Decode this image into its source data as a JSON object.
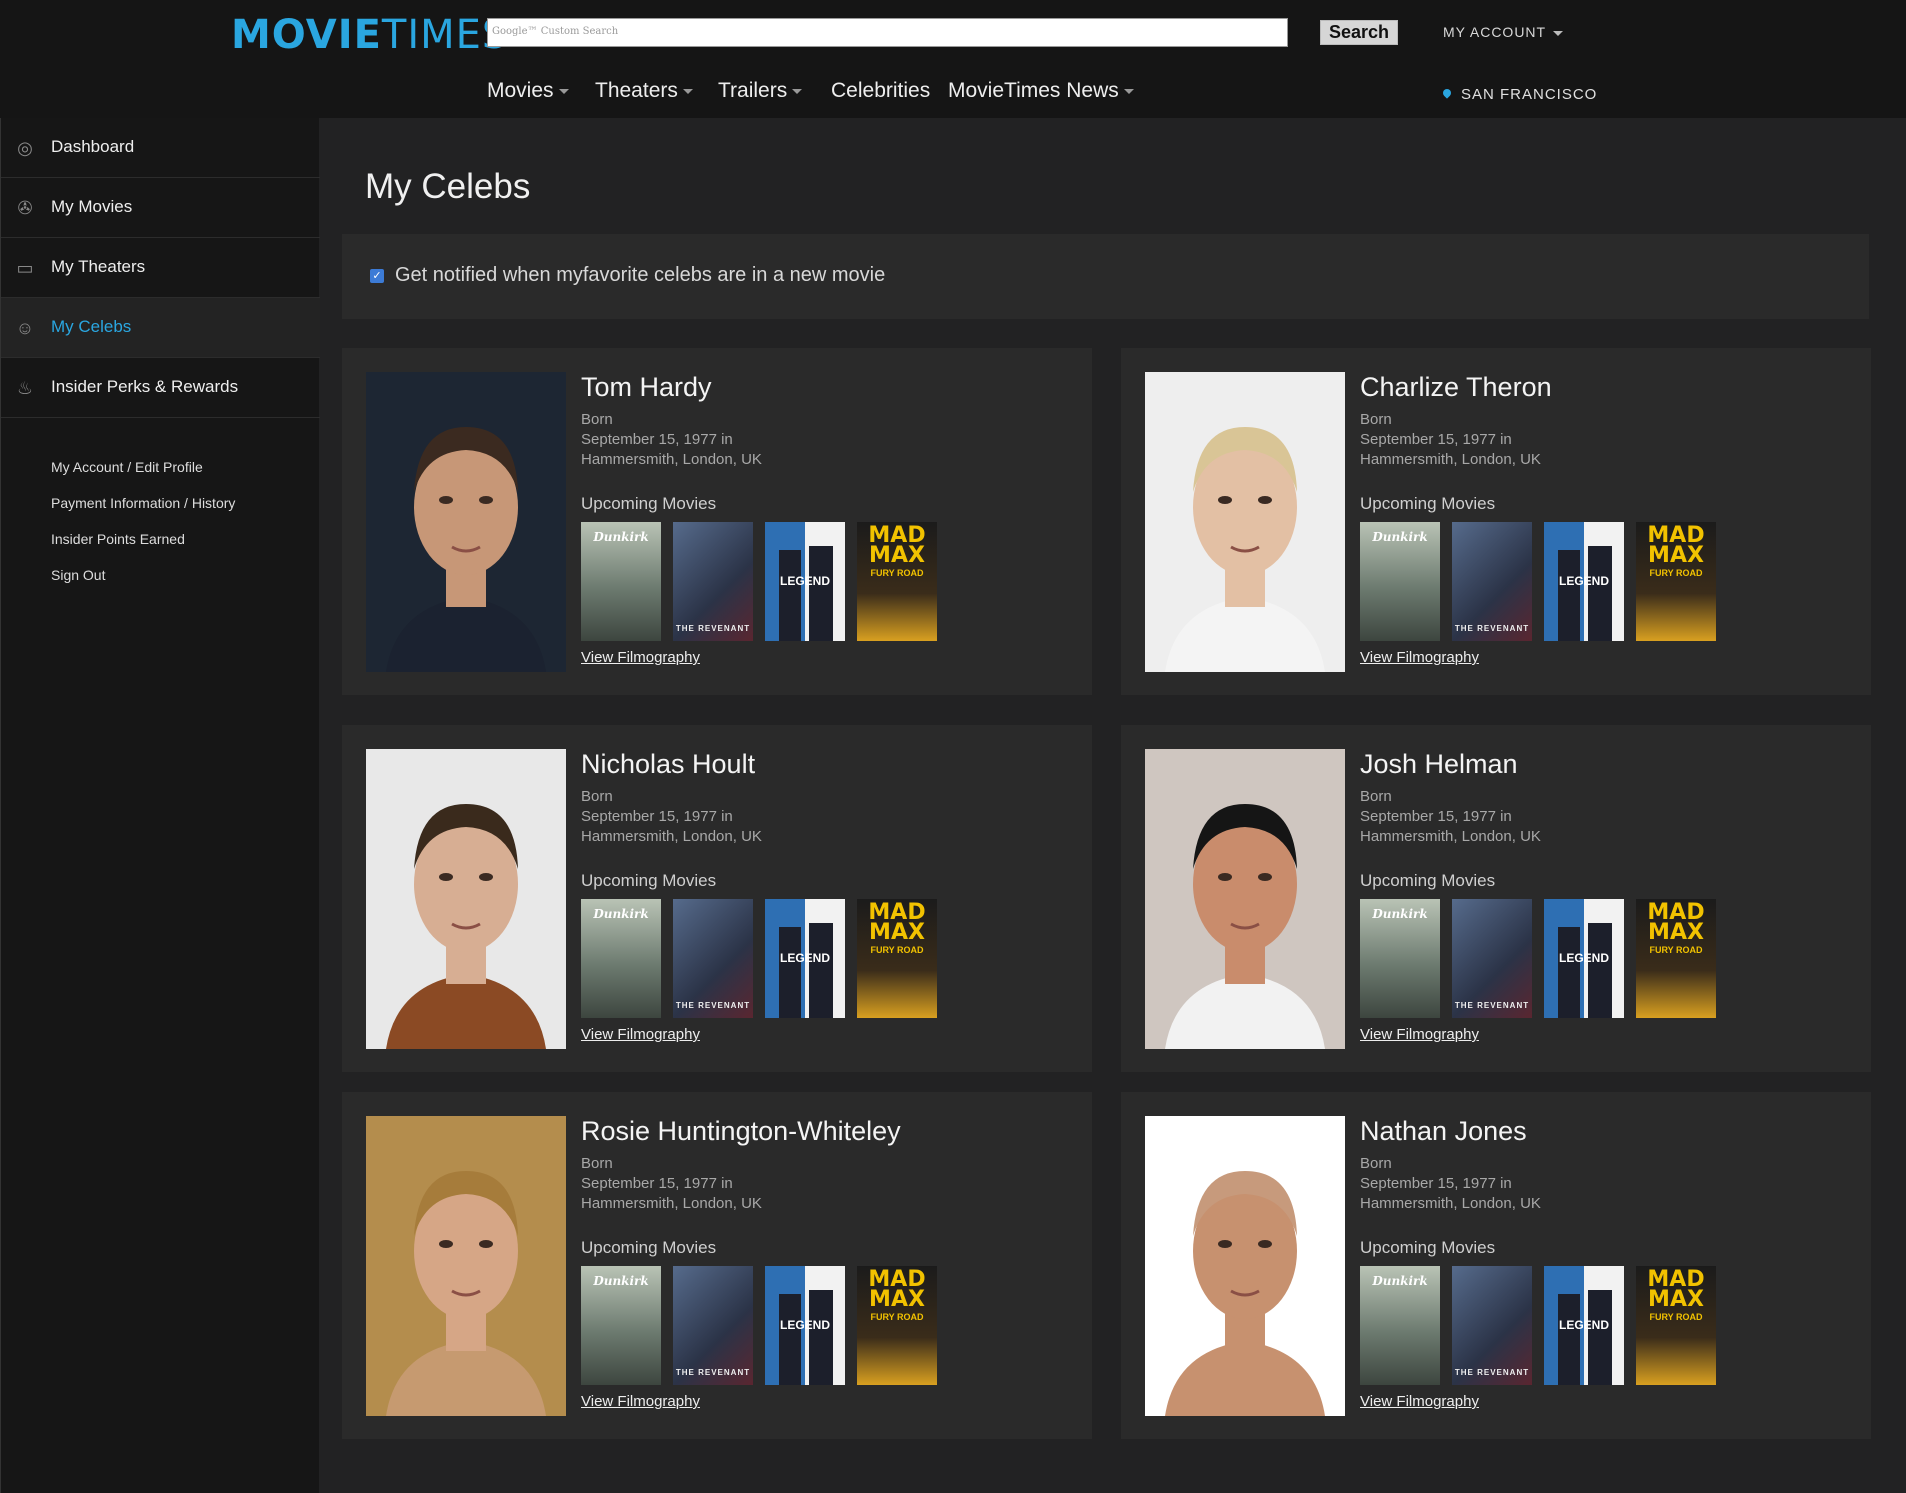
{
  "header": {
    "logo_bold": "MOVIE",
    "logo_light": "TIMES",
    "search_placeholder": "Google™ Custom Search",
    "search_button": "Search",
    "account_label": "MY ACCOUNT",
    "location": "SAN FRANCISCO",
    "nav": [
      "Movies",
      "Theaters",
      "Trailers",
      "Celebrities",
      "MovieTimes News"
    ]
  },
  "sidebar": {
    "items": [
      "Dashboard",
      "My Movies",
      "My Theaters",
      "My Celebs",
      "Insider Perks & Rewards"
    ],
    "icons": [
      "dashboard-icon",
      "film-reel-icon",
      "monitor-icon",
      "person-icon",
      "drink-cup-icon"
    ],
    "links": [
      "My Account / Edit Profile",
      "Payment Information / History",
      "Insider Points Earned",
      "Sign Out"
    ]
  },
  "main": {
    "title": "My Celebs",
    "notify_text": "Get notified when myfavorite celebs are in a new movie",
    "notify_checked": true
  },
  "card_labels": {
    "born": "Born",
    "upcoming": "Upcoming Movies",
    "filmography": "View Filmography"
  },
  "posters": [
    {
      "title": "Dunkirk",
      "bg": "#7f8f84"
    },
    {
      "title": "THE REVENANT",
      "bg": "#3d4a63"
    },
    {
      "title": "LEGEND",
      "bg": "#2e6fb3"
    },
    {
      "title": "MAD MAX",
      "subtitle": "FURY ROAD",
      "bg": "#e7b615"
    }
  ],
  "celebs": [
    {
      "name": "Tom Hardy",
      "born_date": "September 15, 1977 in",
      "born_place": "Hammersmith, London, UK",
      "photo_bg": "#1d2633",
      "skin": "#c79777"
    },
    {
      "name": "Charlize Theron",
      "born_date": "September 15, 1977 in",
      "born_place": "Hammersmith, London, UK",
      "photo_bg": "#eeeeee",
      "skin": "#e3c0a4"
    },
    {
      "name": "Nicholas Hoult",
      "born_date": "September 15, 1977 in",
      "born_place": "Hammersmith, London, UK",
      "photo_bg": "#e8e8e8",
      "skin": "#d7ae93"
    },
    {
      "name": "Josh Helman",
      "born_date": "September 15, 1977 in",
      "born_place": "Hammersmith, London, UK",
      "photo_bg": "#cfc6c0",
      "skin": "#c98c6c"
    },
    {
      "name": "Rosie Huntington-Whiteley",
      "born_date": "September 15, 1977 in",
      "born_place": "Hammersmith, London, UK",
      "photo_bg": "#b48d4d",
      "skin": "#d6a686"
    },
    {
      "name": "Nathan Jones",
      "born_date": "September 15, 1977 in",
      "born_place": "Hammersmith, London, UK",
      "photo_bg": "#ffffff",
      "skin": "#c7916f"
    }
  ],
  "colors": {
    "accent": "#2aa6e0",
    "panel": "#2a2a2a",
    "page": "#222223",
    "header": "#151515"
  }
}
